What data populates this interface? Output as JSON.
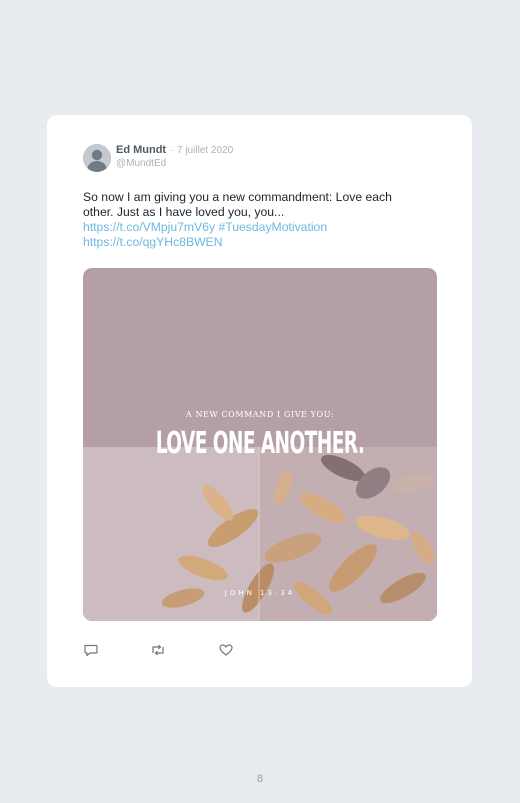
{
  "tweet": {
    "author_name": "Ed Mundt",
    "separator": "·",
    "date": "7 juillet 2020",
    "handle": "@MundtEd",
    "text_line1": "So now I am giving you a new commandment: Love each",
    "text_line2": "other. Just as I have loved you, you...",
    "link1": "https://t.co/VMpju7mV6y",
    "hashtag": "#TuesdayMotivation",
    "link2": "https://t.co/qgYHc8BWEN",
    "media": {
      "subtitle": "A NEW COMMAND I GIVE YOU:",
      "title": "LOVE ONE ANOTHER.",
      "reference": "JOHN 13:34"
    },
    "actions": {
      "reply_icon": "reply-icon",
      "retweet_icon": "retweet-icon",
      "like_icon": "heart-icon"
    }
  },
  "page_number": "8",
  "colors": {
    "background": "#e8ebf0",
    "card": "#ffffff",
    "link": "#6db8e2",
    "muted": "#aab3bb",
    "name": "#4d5a66"
  }
}
